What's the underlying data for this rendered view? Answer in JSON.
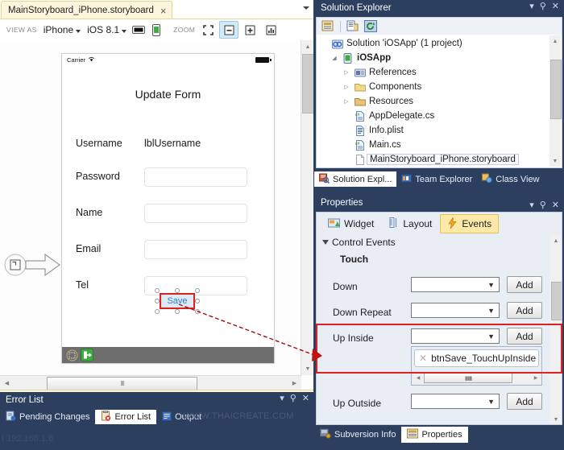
{
  "designer": {
    "tab": {
      "title": "MainStoryboard_iPhone.storyboard",
      "close": "×"
    },
    "toolbar": {
      "view_as_label": "VIEW AS",
      "device": "iPhone",
      "os_version": "iOS 8.1",
      "orientation_landscape_icon": "landscape-icon",
      "orientation_portrait_icon": "portrait-icon",
      "zoom_label": "ZOOM",
      "zoom_fit_icon": "zoom-fit-icon",
      "zoom_out_icon": "zoom-out-icon",
      "zoom_in_icon": "zoom-in-icon",
      "zoom_actual_icon": "zoom-actual-icon"
    },
    "phone": {
      "carrier": "Carrier",
      "wifi_icon": "wifi-icon",
      "battery_icon": "battery-icon",
      "title": "Update Form",
      "fields": [
        {
          "label": "Username",
          "value": "lblUsername",
          "type": "label"
        },
        {
          "label": "Password",
          "value": "",
          "type": "input"
        },
        {
          "label": "Name",
          "value": "",
          "type": "input"
        },
        {
          "label": "Email",
          "value": "",
          "type": "input"
        },
        {
          "label": "Tel",
          "value": "",
          "type": "input"
        }
      ],
      "save_button": "Save"
    },
    "scroll": {
      "thumb_grip": "‖‖"
    }
  },
  "error_list": {
    "title": "Error List",
    "tabs": [
      {
        "label": "Pending Changes",
        "icon": "pending-changes-icon",
        "active": false
      },
      {
        "label": "Error List",
        "icon": "error-list-icon",
        "active": true
      },
      {
        "label": "Output",
        "icon": "output-icon",
        "active": false
      }
    ],
    "watermark": "WWW.THAICREATE.COM",
    "watermark_bottom": "t 192.168.1.6",
    "dropdown_icon": "chevron-down-icon",
    "pin_icon": "pin-icon",
    "close_icon": "close-icon"
  },
  "solution_explorer": {
    "title": "Solution Explorer",
    "toolbar": [
      {
        "icon": "home-properties-icon",
        "name": "properties-window-icon"
      },
      {
        "icon": "show-all-files-icon",
        "name": "show-all-files-icon"
      },
      {
        "icon": "refresh-icon",
        "name": "refresh-icon"
      }
    ],
    "tree": [
      {
        "depth": 0,
        "label": "Solution 'iOSApp' (1 project)",
        "icon": "solution-icon",
        "expander": "",
        "bold": false,
        "selected": false
      },
      {
        "depth": 1,
        "label": "iOSApp",
        "icon": "project-icon",
        "expander": "◢",
        "bold": true,
        "selected": false
      },
      {
        "depth": 2,
        "label": "References",
        "icon": "references-icon",
        "expander": "▷",
        "bold": false,
        "selected": false
      },
      {
        "depth": 2,
        "label": "Components",
        "icon": "folder-icon",
        "expander": "▷",
        "bold": false,
        "selected": false
      },
      {
        "depth": 2,
        "label": "Resources",
        "icon": "folder-icon",
        "expander": "▷",
        "bold": false,
        "selected": false
      },
      {
        "depth": 2,
        "label": "AppDelegate.cs",
        "icon": "csharp-file-icon",
        "expander": "",
        "bold": false,
        "selected": false
      },
      {
        "depth": 2,
        "label": "Info.plist",
        "icon": "plist-file-icon",
        "expander": "",
        "bold": false,
        "selected": false
      },
      {
        "depth": 2,
        "label": "Main.cs",
        "icon": "csharp-file-icon",
        "expander": "",
        "bold": false,
        "selected": false
      },
      {
        "depth": 2,
        "label": "MainStoryboard_iPhone.storyboard",
        "icon": "storyboard-file-icon",
        "expander": "",
        "bold": false,
        "selected": true
      }
    ],
    "tabs": [
      {
        "label": "Solution Expl...",
        "icon": "solution-explorer-icon",
        "active": true
      },
      {
        "label": "Team Explorer",
        "icon": "team-explorer-icon",
        "active": false
      },
      {
        "label": "Class View",
        "icon": "class-view-icon",
        "active": false
      }
    ],
    "dropdown_icon": "chevron-down-icon",
    "pin_icon": "pin-icon",
    "close_icon": "close-icon"
  },
  "properties": {
    "title": "Properties",
    "tabs": [
      {
        "label": "Widget",
        "icon": "widget-icon",
        "active": false
      },
      {
        "label": "Layout",
        "icon": "layout-icon",
        "active": false
      },
      {
        "label": "Events",
        "icon": "events-lightning-icon",
        "active": true
      }
    ],
    "section": "Control Events",
    "group": "Touch",
    "events": [
      {
        "label": "Down",
        "value": "",
        "add": "Add",
        "handlers": []
      },
      {
        "label": "Down Repeat",
        "value": "",
        "add": "Add",
        "handlers": []
      },
      {
        "label": "Up Inside",
        "value": "",
        "add": "Add",
        "handlers": [
          "btnSave_TouchUpInside"
        ],
        "highlighted": true
      },
      {
        "label": "Up Outside",
        "value": "",
        "add": "Add",
        "handlers": []
      }
    ],
    "handler_remove_icon": "remove-x-icon",
    "bottom_tabs": [
      {
        "label": "Subversion Info",
        "icon": "subversion-icon",
        "active": false
      },
      {
        "label": "Properties",
        "icon": "properties-icon",
        "active": true
      }
    ],
    "dropdown_icon": "chevron-down-icon",
    "pin_icon": "pin-icon",
    "close_icon": "close-icon"
  },
  "colors": {
    "chrome": "#2d3f5f",
    "tab_active_doc": "#fdf6dd",
    "tab_active_events": "#fce9a8",
    "highlight_red": "#e02020",
    "selection_blue": "#2f7fd8"
  }
}
